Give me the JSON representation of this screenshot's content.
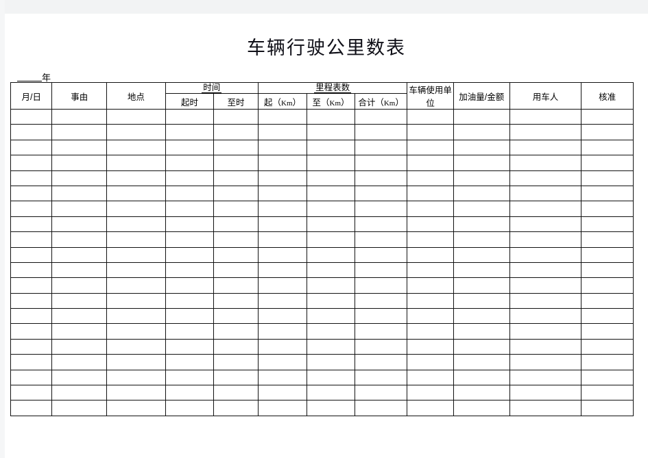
{
  "document": {
    "title": "车辆行驶公里数表",
    "year_blank_label": "年"
  },
  "table": {
    "group_headers": {
      "time": "时间",
      "odometer": "里程表数"
    },
    "columns": [
      {
        "key": "date",
        "label": "月/日",
        "group": null
      },
      {
        "key": "reason",
        "label": "事由",
        "group": null
      },
      {
        "key": "place",
        "label": "地点",
        "group": null
      },
      {
        "key": "time_from",
        "label": "起时",
        "group": "时间"
      },
      {
        "key": "time_to",
        "label": "至时",
        "group": "时间"
      },
      {
        "key": "km_from",
        "label": "起（Km）",
        "group": "里程表数"
      },
      {
        "key": "km_to",
        "label": "至（Km）",
        "group": "里程表数"
      },
      {
        "key": "km_total",
        "label": "合计（Km）",
        "group": "里程表数"
      },
      {
        "key": "unit",
        "label": "车辆使用单位",
        "group": null
      },
      {
        "key": "fuel",
        "label": "加油量/金额",
        "group": null
      },
      {
        "key": "driver",
        "label": "用车人",
        "group": null
      },
      {
        "key": "approve",
        "label": "核准",
        "group": null
      }
    ],
    "km_labels": {
      "from_prefix": "起（",
      "to_prefix": "至（",
      "total_prefix": "合计（",
      "unit": "Km",
      "suffix": "）"
    },
    "row_count": 20,
    "rows": [
      [
        "",
        "",
        "",
        "",
        "",
        "",
        "",
        "",
        "",
        "",
        "",
        ""
      ],
      [
        "",
        "",
        "",
        "",
        "",
        "",
        "",
        "",
        "",
        "",
        "",
        ""
      ],
      [
        "",
        "",
        "",
        "",
        "",
        "",
        "",
        "",
        "",
        "",
        "",
        ""
      ],
      [
        "",
        "",
        "",
        "",
        "",
        "",
        "",
        "",
        "",
        "",
        "",
        ""
      ],
      [
        "",
        "",
        "",
        "",
        "",
        "",
        "",
        "",
        "",
        "",
        "",
        ""
      ],
      [
        "",
        "",
        "",
        "",
        "",
        "",
        "",
        "",
        "",
        "",
        "",
        ""
      ],
      [
        "",
        "",
        "",
        "",
        "",
        "",
        "",
        "",
        "",
        "",
        "",
        ""
      ],
      [
        "",
        "",
        "",
        "",
        "",
        "",
        "",
        "",
        "",
        "",
        "",
        ""
      ],
      [
        "",
        "",
        "",
        "",
        "",
        "",
        "",
        "",
        "",
        "",
        "",
        ""
      ],
      [
        "",
        "",
        "",
        "",
        "",
        "",
        "",
        "",
        "",
        "",
        "",
        ""
      ],
      [
        "",
        "",
        "",
        "",
        "",
        "",
        "",
        "",
        "",
        "",
        "",
        ""
      ],
      [
        "",
        "",
        "",
        "",
        "",
        "",
        "",
        "",
        "",
        "",
        "",
        ""
      ],
      [
        "",
        "",
        "",
        "",
        "",
        "",
        "",
        "",
        "",
        "",
        "",
        ""
      ],
      [
        "",
        "",
        "",
        "",
        "",
        "",
        "",
        "",
        "",
        "",
        "",
        ""
      ],
      [
        "",
        "",
        "",
        "",
        "",
        "",
        "",
        "",
        "",
        "",
        "",
        ""
      ],
      [
        "",
        "",
        "",
        "",
        "",
        "",
        "",
        "",
        "",
        "",
        "",
        ""
      ],
      [
        "",
        "",
        "",
        "",
        "",
        "",
        "",
        "",
        "",
        "",
        "",
        ""
      ],
      [
        "",
        "",
        "",
        "",
        "",
        "",
        "",
        "",
        "",
        "",
        "",
        ""
      ],
      [
        "",
        "",
        "",
        "",
        "",
        "",
        "",
        "",
        "",
        "",
        "",
        ""
      ],
      [
        "",
        "",
        "",
        "",
        "",
        "",
        "",
        "",
        "",
        "",
        "",
        ""
      ]
    ]
  },
  "colors": {
    "text": "#000000",
    "title": "#101018",
    "grid": "#111111",
    "chrome": "#f2f3f4"
  }
}
